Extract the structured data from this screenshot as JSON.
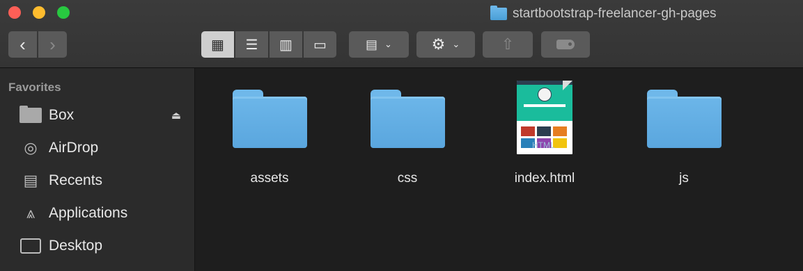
{
  "window": {
    "title": "startbootstrap-freelancer-gh-pages"
  },
  "toolbar": {
    "back_icon": "‹",
    "forward_icon": "›",
    "view_icons": [
      "▦",
      "☰",
      "▥",
      "▭"
    ],
    "group_icon": "▤",
    "action_icon": "⚙",
    "share_icon": "⇧",
    "chevron": "⌄"
  },
  "sidebar": {
    "heading": "Favorites",
    "items": [
      {
        "label": "Box",
        "icon": "folder-icon"
      },
      {
        "label": "AirDrop",
        "icon": "airdrop-icon",
        "glyph": "◎"
      },
      {
        "label": "Recents",
        "icon": "recents-icon",
        "glyph": "▤"
      },
      {
        "label": "Applications",
        "icon": "applications-icon",
        "glyph": "⩓"
      },
      {
        "label": "Desktop",
        "icon": "desktop-icon"
      }
    ],
    "eject_glyph": "⏏"
  },
  "files": [
    {
      "name": "assets",
      "kind": "folder"
    },
    {
      "name": "css",
      "kind": "folder"
    },
    {
      "name": "index.html",
      "kind": "html",
      "thumb_badge": "HTML"
    },
    {
      "name": "js",
      "kind": "folder"
    }
  ],
  "colors": {
    "folder": "#5aa6de",
    "accent_teal": "#1abc9c",
    "window_bg": "#1e1e1e",
    "sidebar_bg": "#2b2b2b"
  }
}
